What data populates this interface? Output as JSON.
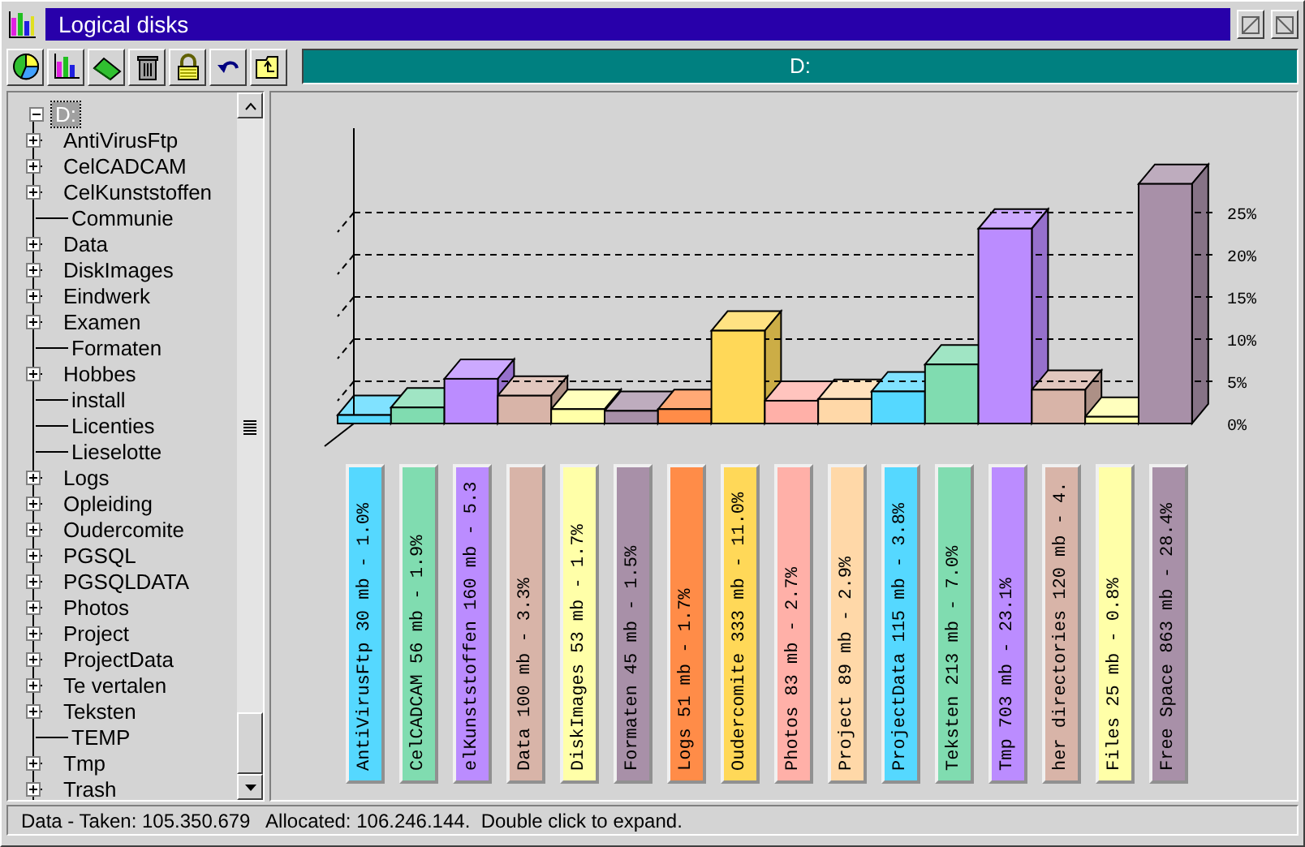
{
  "window": {
    "title": "Logical disks"
  },
  "toolbar": {
    "path_label": "D:"
  },
  "tree": {
    "root": {
      "label": "D:",
      "selected": true,
      "expanded": true,
      "children": [
        {
          "label": "AntiVirusFtp",
          "expandable": true,
          "selected": false
        },
        {
          "label": "CelCADCAM",
          "expandable": true,
          "selected": false
        },
        {
          "label": "CelKunststoffen",
          "expandable": true,
          "selected": false
        },
        {
          "label": "Communie",
          "expandable": false,
          "selected": false
        },
        {
          "label": "Data",
          "expandable": true,
          "selected": false
        },
        {
          "label": "DiskImages",
          "expandable": true,
          "selected": false
        },
        {
          "label": "Eindwerk",
          "expandable": true,
          "selected": false
        },
        {
          "label": "Examen",
          "expandable": true,
          "selected": false
        },
        {
          "label": "Formaten",
          "expandable": false,
          "selected": false
        },
        {
          "label": "Hobbes",
          "expandable": true,
          "selected": false
        },
        {
          "label": "install",
          "expandable": false,
          "selected": false
        },
        {
          "label": "Licenties",
          "expandable": false,
          "selected": false
        },
        {
          "label": "Lieselotte",
          "expandable": false,
          "selected": false
        },
        {
          "label": "Logs",
          "expandable": true,
          "selected": false
        },
        {
          "label": "Opleiding",
          "expandable": true,
          "selected": false
        },
        {
          "label": "Oudercomite",
          "expandable": true,
          "selected": false
        },
        {
          "label": "PGSQL",
          "expandable": true,
          "selected": false
        },
        {
          "label": "PGSQLDATA",
          "expandable": true,
          "selected": false
        },
        {
          "label": "Photos",
          "expandable": true,
          "selected": false
        },
        {
          "label": "Project",
          "expandable": true,
          "selected": false
        },
        {
          "label": "ProjectData",
          "expandable": true,
          "selected": false
        },
        {
          "label": "Te vertalen",
          "expandable": true,
          "selected": false
        },
        {
          "label": "Teksten",
          "expandable": true,
          "selected": false
        },
        {
          "label": "TEMP",
          "expandable": false,
          "selected": false
        },
        {
          "label": "Tmp",
          "expandable": true,
          "selected": false
        },
        {
          "label": "Trash",
          "expandable": true,
          "selected": false
        }
      ]
    }
  },
  "chart": {
    "chart_data": {
      "type": "bar",
      "ylim": [
        0,
        35
      ],
      "grid": true,
      "values": [
        1.0,
        1.9,
        5.3,
        3.3,
        1.7,
        1.5,
        1.7,
        11.0,
        2.7,
        2.9,
        3.8,
        7.0,
        23.1,
        4.0,
        0.8,
        28.4
      ],
      "yticks": [
        {
          "value": 0,
          "label": "0%"
        },
        {
          "value": 5,
          "label": "5%"
        },
        {
          "value": 10,
          "label": "10%"
        },
        {
          "value": 15,
          "label": "15%"
        },
        {
          "value": 20,
          "label": "20%"
        },
        {
          "value": 25,
          "label": "25%"
        }
      ]
    },
    "legend": [
      {
        "text": "AntiVirusFtp 30 mb - 1.0%",
        "color": "#55d8ff"
      },
      {
        "text": "CelCADCAM 56 mb - 1.9%",
        "color": "#80dcb0"
      },
      {
        "text": "elKunststoffen 160 mb - 5.3",
        "color": "#bb8cff"
      },
      {
        "text": "Data 100 mb - 3.3%",
        "color": "#d8b4a8"
      },
      {
        "text": "DiskImages 53 mb - 1.7%",
        "color": "#ffffa8"
      },
      {
        "text": "Formaten 45 mb - 1.5%",
        "color": "#a890a8"
      },
      {
        "text": "Logs 51 mb - 1.7%",
        "color": "#ff8c48"
      },
      {
        "text": "Oudercomite 333 mb - 11.0%",
        "color": "#ffd858"
      },
      {
        "text": "Photos 83 mb - 2.7%",
        "color": "#ffb0a8"
      },
      {
        "text": "Project 89 mb - 2.9%",
        "color": "#ffd8a8"
      },
      {
        "text": "ProjectData 115 mb - 3.8%",
        "color": "#55d8ff"
      },
      {
        "text": "Teksten 213 mb - 7.0%",
        "color": "#80dcb0"
      },
      {
        "text": "Tmp 703 mb - 23.1%",
        "color": "#bb8cff"
      },
      {
        "text": "her directories 120 mb - 4.",
        "color": "#d8b4a8"
      },
      {
        "text": "Files 25 mb - 0.8%",
        "color": "#ffffa8"
      },
      {
        "text": "Free Space 863 mb - 28.4%",
        "color": "#a890a8"
      }
    ]
  },
  "status_bar": "Data - Taken: 105.350.679   Allocated: 106.246.144.  Double click to expand."
}
